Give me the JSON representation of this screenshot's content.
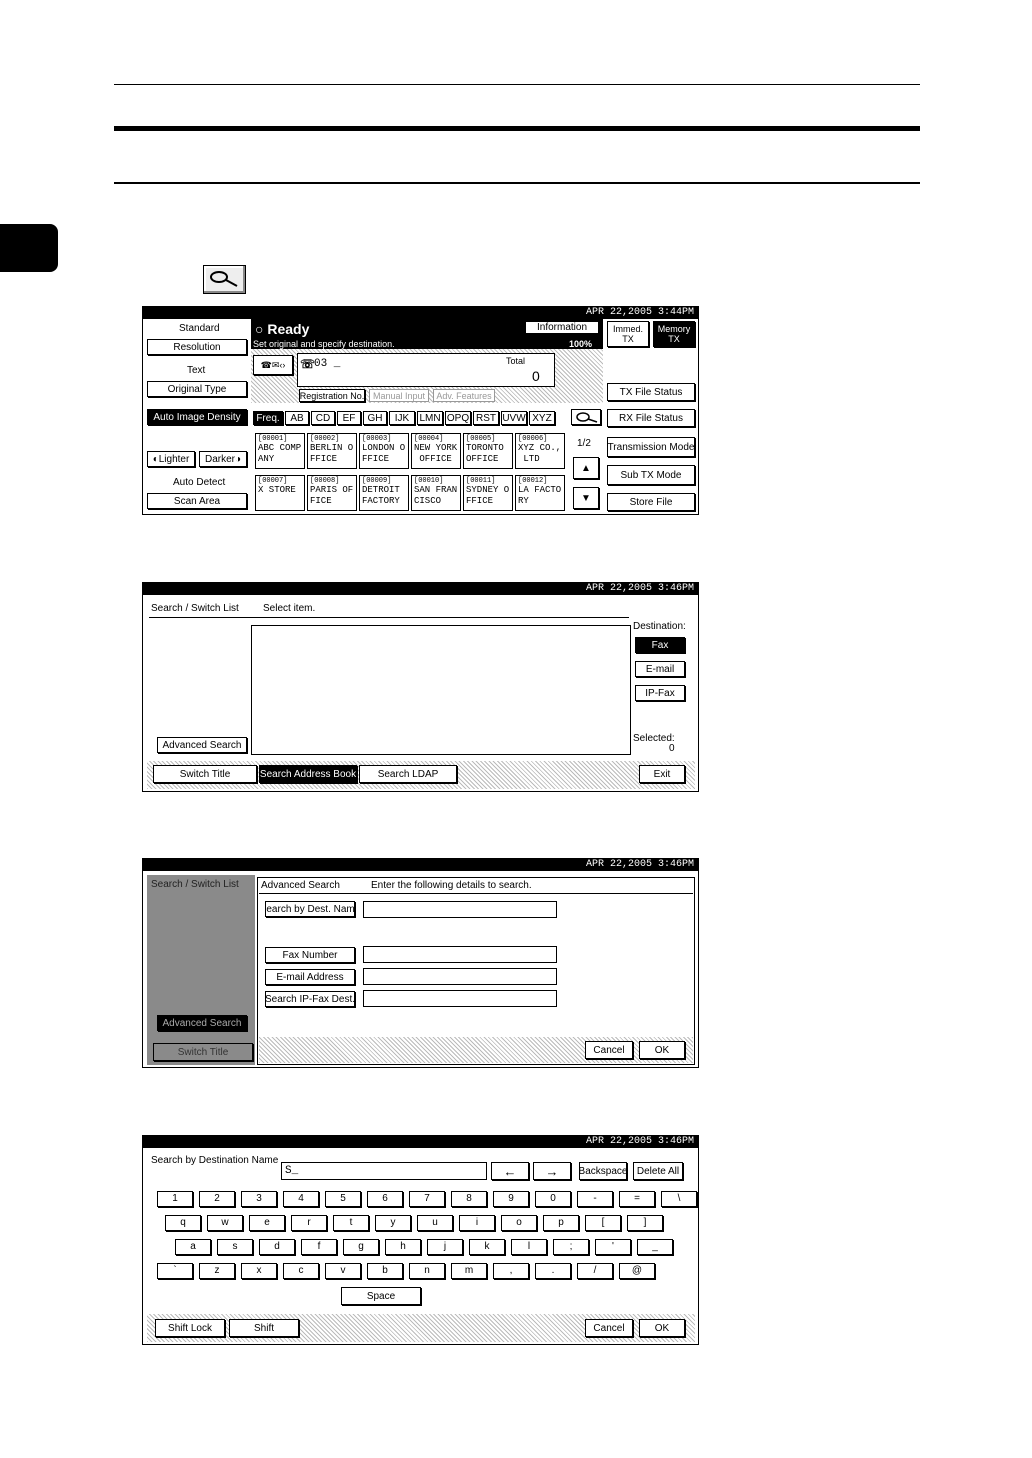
{
  "panel1": {
    "datetime": "APR  22,2005  3:44PM",
    "ready": "Ready",
    "instruction": "Set original and specify destination.",
    "information": "Information",
    "percent": "100%",
    "left": {
      "standard": "Standard",
      "resolution": "Resolution",
      "text": "Text",
      "original_type": "Original Type",
      "auto_image_density": "Auto Image Density",
      "lighter": "Lighter",
      "darker": "Darker",
      "auto_detect": "Auto Detect",
      "scan_area": "Scan Area"
    },
    "dest_number": "03 _",
    "total_label": "Total",
    "total_value": "0",
    "tabs": [
      "Registration No.",
      "Manual Input",
      "Adv. Features"
    ],
    "freq_tabs": [
      "Freq.",
      "AB",
      "CD",
      "EF",
      "GH",
      "IJK",
      "LMN",
      "OPQ",
      "RST",
      "UVW",
      "XYZ"
    ],
    "page": "1/2",
    "dests": [
      {
        "no": "[00001]",
        "name": "ABC COMP\nANY"
      },
      {
        "no": "[00002]",
        "name": "BERLIN O\nFFICE"
      },
      {
        "no": "[00003]",
        "name": "LONDON O\nFFICE"
      },
      {
        "no": "[00004]",
        "name": "NEW YORK\n OFFICE"
      },
      {
        "no": "[00005]",
        "name": "TORONTO\nOFFICE"
      },
      {
        "no": "[00006]",
        "name": "XYZ CO.,\n LTD"
      },
      {
        "no": "[00007]",
        "name": "X STORE"
      },
      {
        "no": "[00008]",
        "name": "PARIS OF\nFICE"
      },
      {
        "no": "[00009]",
        "name": "DETROIT\nFACTORY"
      },
      {
        "no": "[00010]",
        "name": "SAN FRAN\nCISCO"
      },
      {
        "no": "[00011]",
        "name": "SYDNEY O\nFFICE"
      },
      {
        "no": "[00012]",
        "name": "LA FACTO\nRY"
      }
    ],
    "right": {
      "immed_tx": "Immed. TX",
      "memory_tx": "Memory TX",
      "tx_file_status": "TX File Status",
      "rx_file_status": "RX File Status",
      "transmission_mode": "Transmission Mode",
      "sub_tx_mode": "Sub TX Mode",
      "store_file": "Store File"
    }
  },
  "panel2": {
    "datetime": "APR  22,2005  3:46PM",
    "title": "Search / Switch List",
    "prompt": "Select item.",
    "destination_label": "Destination:",
    "fax": "Fax",
    "email": "E-mail",
    "ipfax": "IP-Fax",
    "selected_label": "Selected:",
    "selected_value": "0",
    "advanced_search": "Advanced Search",
    "switch_title": "Switch Title",
    "search_address_book": "Search Address Book",
    "search_ldap": "Search LDAP",
    "exit": "Exit"
  },
  "panel3": {
    "datetime": "APR  22,2005  3:46PM",
    "title": "Search / Switch List",
    "adv_title": "Advanced Search",
    "prompt": "Enter the following details to search.",
    "search_by_dest_name": "Search by Dest. Name",
    "fax_number": "Fax Number",
    "email_address": "E-mail Address",
    "search_ipfax": "Search IP-Fax Dest.",
    "advanced_search": "Advanced Search",
    "switch_title": "Switch Title",
    "cancel": "Cancel",
    "ok": "OK"
  },
  "panel4": {
    "datetime": "APR  22,2005  3:46PM",
    "title": "Search by Destination Name",
    "input_value": "S_",
    "backspace": "Backspace",
    "delete_all": "Delete All",
    "row1": [
      "1",
      "2",
      "3",
      "4",
      "5",
      "6",
      "7",
      "8",
      "9",
      "0",
      "-",
      "=",
      "\\"
    ],
    "row2": [
      "q",
      "w",
      "e",
      "r",
      "t",
      "y",
      "u",
      "i",
      "o",
      "p",
      "[",
      "]"
    ],
    "row3": [
      "a",
      "s",
      "d",
      "f",
      "g",
      "h",
      "j",
      "k",
      "l",
      ";",
      "'",
      "_"
    ],
    "row4": [
      "`",
      "z",
      "x",
      "c",
      "v",
      "b",
      "n",
      "m",
      ",",
      ".",
      "/",
      "@"
    ],
    "space": "Space",
    "shift_lock": "Shift Lock",
    "shift": "Shift",
    "cancel": "Cancel",
    "ok": "OK"
  }
}
